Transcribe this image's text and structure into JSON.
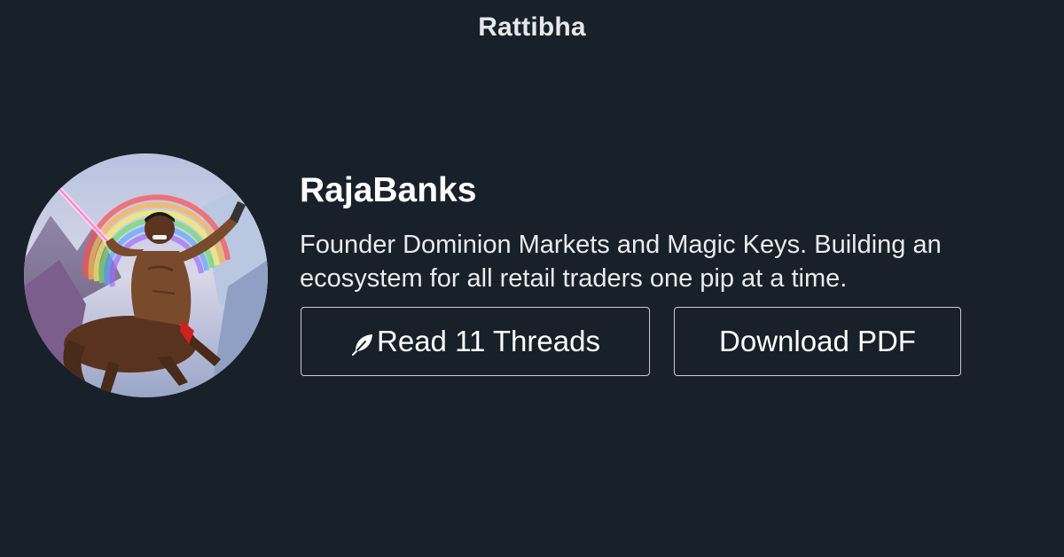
{
  "site": {
    "brand": "Rattibha"
  },
  "profile": {
    "username": "RajaBanks",
    "bio": "Founder Dominion Markets and Magic Keys. Building an ecosystem for all retail traders one pip at a time.",
    "avatar_icon": "centaur-rainbow-avatar"
  },
  "actions": {
    "read_icon": "feather-icon",
    "read_label": "Read 11 Threads",
    "download_label": "Download PDF"
  },
  "colors": {
    "background": "#18202a",
    "text": "#ffffff",
    "button_border": "#c9cdd2"
  }
}
